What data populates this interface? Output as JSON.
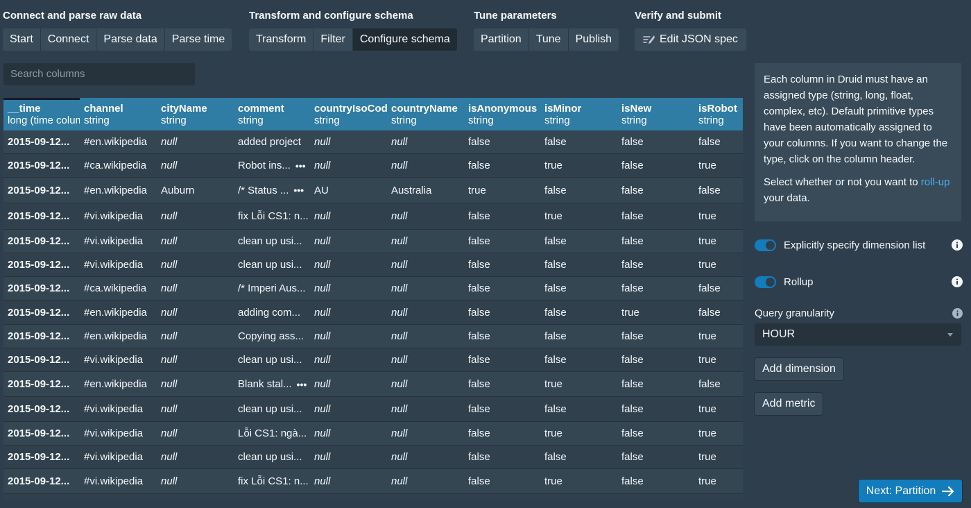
{
  "steps": {
    "groups": [
      {
        "title": "Connect and parse raw data",
        "buttons": [
          "Start",
          "Connect",
          "Parse data",
          "Parse time"
        ]
      },
      {
        "title": "Transform and configure schema",
        "buttons": [
          "Transform",
          "Filter",
          "Configure schema"
        ]
      },
      {
        "title": "Tune parameters",
        "buttons": [
          "Partition",
          "Tune",
          "Publish"
        ]
      },
      {
        "title": "Verify and submit",
        "buttons": [
          "Edit JSON spec"
        ]
      }
    ],
    "active": "Configure schema"
  },
  "search": {
    "placeholder": "Search columns"
  },
  "table": {
    "columns": [
      {
        "name": "__time",
        "type": "long (time column)"
      },
      {
        "name": "channel",
        "type": "string"
      },
      {
        "name": "cityName",
        "type": "string"
      },
      {
        "name": "comment",
        "type": "string"
      },
      {
        "name": "countryIsoCode",
        "type": "string"
      },
      {
        "name": "countryName",
        "type": "string"
      },
      {
        "name": "isAnonymous",
        "type": "string"
      },
      {
        "name": "isMinor",
        "type": "string"
      },
      {
        "name": "isNew",
        "type": "string"
      },
      {
        "name": "isRobot",
        "type": "string"
      }
    ],
    "rows": [
      [
        "2015-09-12...",
        "#en.wikipedia",
        "null",
        "added project",
        "null",
        "null",
        "false",
        "false",
        "false",
        "false"
      ],
      [
        "2015-09-12...",
        "#ca.wikipedia",
        "null",
        "Robot ins...",
        "null",
        "null",
        "false",
        "true",
        "false",
        "true"
      ],
      [
        "2015-09-12...",
        "#en.wikipedia",
        "Auburn",
        "/* Status ...",
        "AU",
        "Australia",
        "true",
        "false",
        "false",
        "false"
      ],
      [
        "2015-09-12...",
        "#vi.wikipedia",
        "null",
        "fix Lỗi CS1: n...",
        "null",
        "null",
        "false",
        "true",
        "false",
        "true"
      ],
      [
        "2015-09-12...",
        "#vi.wikipedia",
        "null",
        "clean up usi...",
        "null",
        "null",
        "false",
        "false",
        "false",
        "true"
      ],
      [
        "2015-09-12...",
        "#vi.wikipedia",
        "null",
        "clean up usi...",
        "null",
        "null",
        "false",
        "false",
        "false",
        "true"
      ],
      [
        "2015-09-12...",
        "#ca.wikipedia",
        "null",
        "/* Imperi Aus...",
        "null",
        "null",
        "false",
        "false",
        "false",
        "false"
      ],
      [
        "2015-09-12...",
        "#en.wikipedia",
        "null",
        "adding com...",
        "null",
        "null",
        "false",
        "false",
        "true",
        "false"
      ],
      [
        "2015-09-12...",
        "#en.wikipedia",
        "null",
        "Copying ass...",
        "null",
        "null",
        "false",
        "false",
        "false",
        "true"
      ],
      [
        "2015-09-12...",
        "#vi.wikipedia",
        "null",
        "clean up usi...",
        "null",
        "null",
        "false",
        "false",
        "false",
        "true"
      ],
      [
        "2015-09-12...",
        "#en.wikipedia",
        "null",
        "Blank stal...",
        "null",
        "null",
        "false",
        "true",
        "false",
        "false"
      ],
      [
        "2015-09-12...",
        "#vi.wikipedia",
        "null",
        "clean up usi...",
        "null",
        "null",
        "false",
        "false",
        "false",
        "true"
      ],
      [
        "2015-09-12...",
        "#vi.wikipedia",
        "null",
        "Lỗi CS1: ngà...",
        "null",
        "null",
        "false",
        "true",
        "false",
        "true"
      ],
      [
        "2015-09-12...",
        "#vi.wikipedia",
        "null",
        "clean up usi...",
        "null",
        "null",
        "false",
        "false",
        "false",
        "true"
      ],
      [
        "2015-09-12...",
        "#vi.wikipedia",
        "null",
        "fix Lỗi CS1: n...",
        "null",
        "null",
        "false",
        "true",
        "false",
        "true"
      ]
    ],
    "expand_marker": "•••",
    "expandable_rows": [
      1,
      2,
      10
    ]
  },
  "help": {
    "paragraph1": "Each column in Druid must have an assigned type (string, long, float, complex, etc). Default primitive types have been automatically assigned to your columns. If you want to change the type, click on the column header.",
    "paragraph2_before": "Select whether or not you want to ",
    "paragraph2_link": "roll-up",
    "paragraph2_after": " your data."
  },
  "controls": {
    "explicit_dimensions_label": "Explicitly specify dimension list",
    "explicit_dimensions_on": true,
    "rollup_label": "Rollup",
    "rollup_on": true,
    "query_granularity_label": "Query granularity",
    "query_granularity_value": "HOUR",
    "add_dimension_label": "Add dimension",
    "add_metric_label": "Add metric",
    "next_label": "Next: Partition"
  },
  "colors": {
    "background": "#2f3e4d",
    "header": "#2f7ca4",
    "accent": "#137cbd",
    "link": "#48aff0"
  },
  "icons": {
    "json_spec": "wrench-list-icon",
    "info": "info-icon",
    "next": "arrow-right-icon"
  }
}
